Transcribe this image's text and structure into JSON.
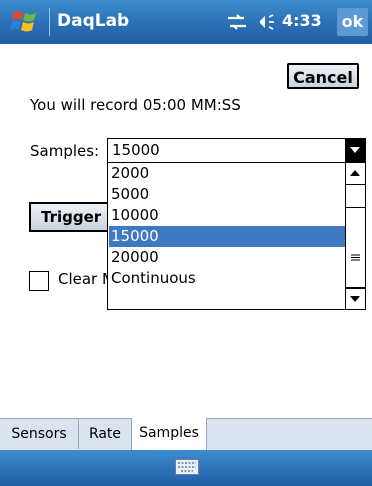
{
  "titlebar": {
    "app_title": "DaqLab",
    "clock": "4:33",
    "ok_label": "ok",
    "icons": [
      "windows-start-icon",
      "connectivity-icon",
      "speaker-icon"
    ]
  },
  "form": {
    "cancel_label": "Cancel",
    "record_text": "You will record 05:00 MM:SS",
    "samples_label": "Samples:",
    "samples_value": "15000",
    "trigger_label": "Trigger",
    "clear_label": "Clear M"
  },
  "dropdown": {
    "options": [
      "2000",
      "5000",
      "10000",
      "15000",
      "20000",
      "Continuous"
    ],
    "selected_index": 3
  },
  "tabs": [
    {
      "label": "Sensors",
      "active": false
    },
    {
      "label": "Rate",
      "active": false
    },
    {
      "label": "Samples",
      "active": true
    }
  ],
  "bottombar": {
    "icon": "keyboard-icon"
  },
  "colors": {
    "titlebar": "#2e74b8",
    "selection": "#3e79c2",
    "tabbar": "#d9e4ef"
  }
}
